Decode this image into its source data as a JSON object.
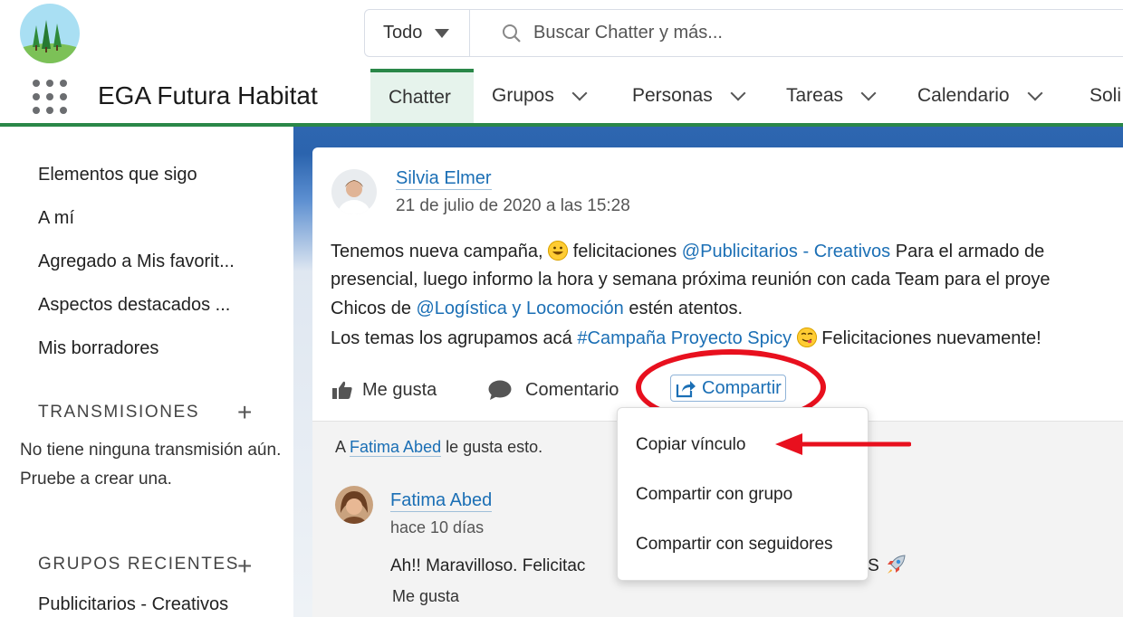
{
  "header": {
    "search_scope": "Todo",
    "search_placeholder": "Buscar Chatter y más..."
  },
  "nav": {
    "app_name": "EGA Futura Habitat",
    "items": [
      {
        "label": "Chatter",
        "active": true
      },
      {
        "label": "Grupos"
      },
      {
        "label": "Personas"
      },
      {
        "label": "Tareas"
      },
      {
        "label": "Calendario"
      },
      {
        "label": "Soli"
      }
    ]
  },
  "sidebar": {
    "items": [
      "Elementos que sigo",
      "A mí",
      "Agregado a Mis favorit...",
      "Aspectos destacados ...",
      "Mis borradores"
    ],
    "streams_title": "TRANSMISIONES",
    "streams_empty": "No tiene ninguna transmisión aún. Pruebe a crear una.",
    "groups_title": "GRUPOS RECIENTES",
    "recent_group": "Publicitarios - Creativos"
  },
  "post": {
    "author": "Silvia Elmer",
    "timestamp": "21 de julio de 2020 a las 15:28",
    "line1_a": "Tenemos nueva campaña,",
    "line1_b": "felicitaciones",
    "mention1": "@Publicitarios - Creativos",
    "line1_c": "Para el armado de",
    "line2": "presencial, luego informo la hora y semana próxima reunión con cada Team para el proye",
    "line3_a": "Chicos de",
    "mention2": "@Logística y Locomoción",
    "line3_b": "estén atentos.",
    "line4_a": "Los temas los agrupamos acá",
    "hashtag": "#Campaña Proyecto Spicy",
    "line4_b": "Felicitaciones nuevamente!",
    "actions": {
      "like": "Me gusta",
      "comment": "Comentario",
      "share": "Compartir"
    }
  },
  "likes": {
    "prefix": "A",
    "user": "Fatima Abed",
    "suffix": "le gusta esto."
  },
  "comment": {
    "author": "Fatima Abed",
    "time": "hace 10 días",
    "text_a": "Ah!! Maravilloso. Felicitac",
    "text_b": "ORES",
    "like": "Me gusta"
  },
  "share_menu": {
    "items": [
      "Copiar vínculo",
      "Compartir con grupo",
      "Compartir con seguidores"
    ]
  },
  "colors": {
    "accent_green": "#2a8748",
    "link_blue": "#1b6fb5",
    "annotation_red": "#e8101e"
  }
}
